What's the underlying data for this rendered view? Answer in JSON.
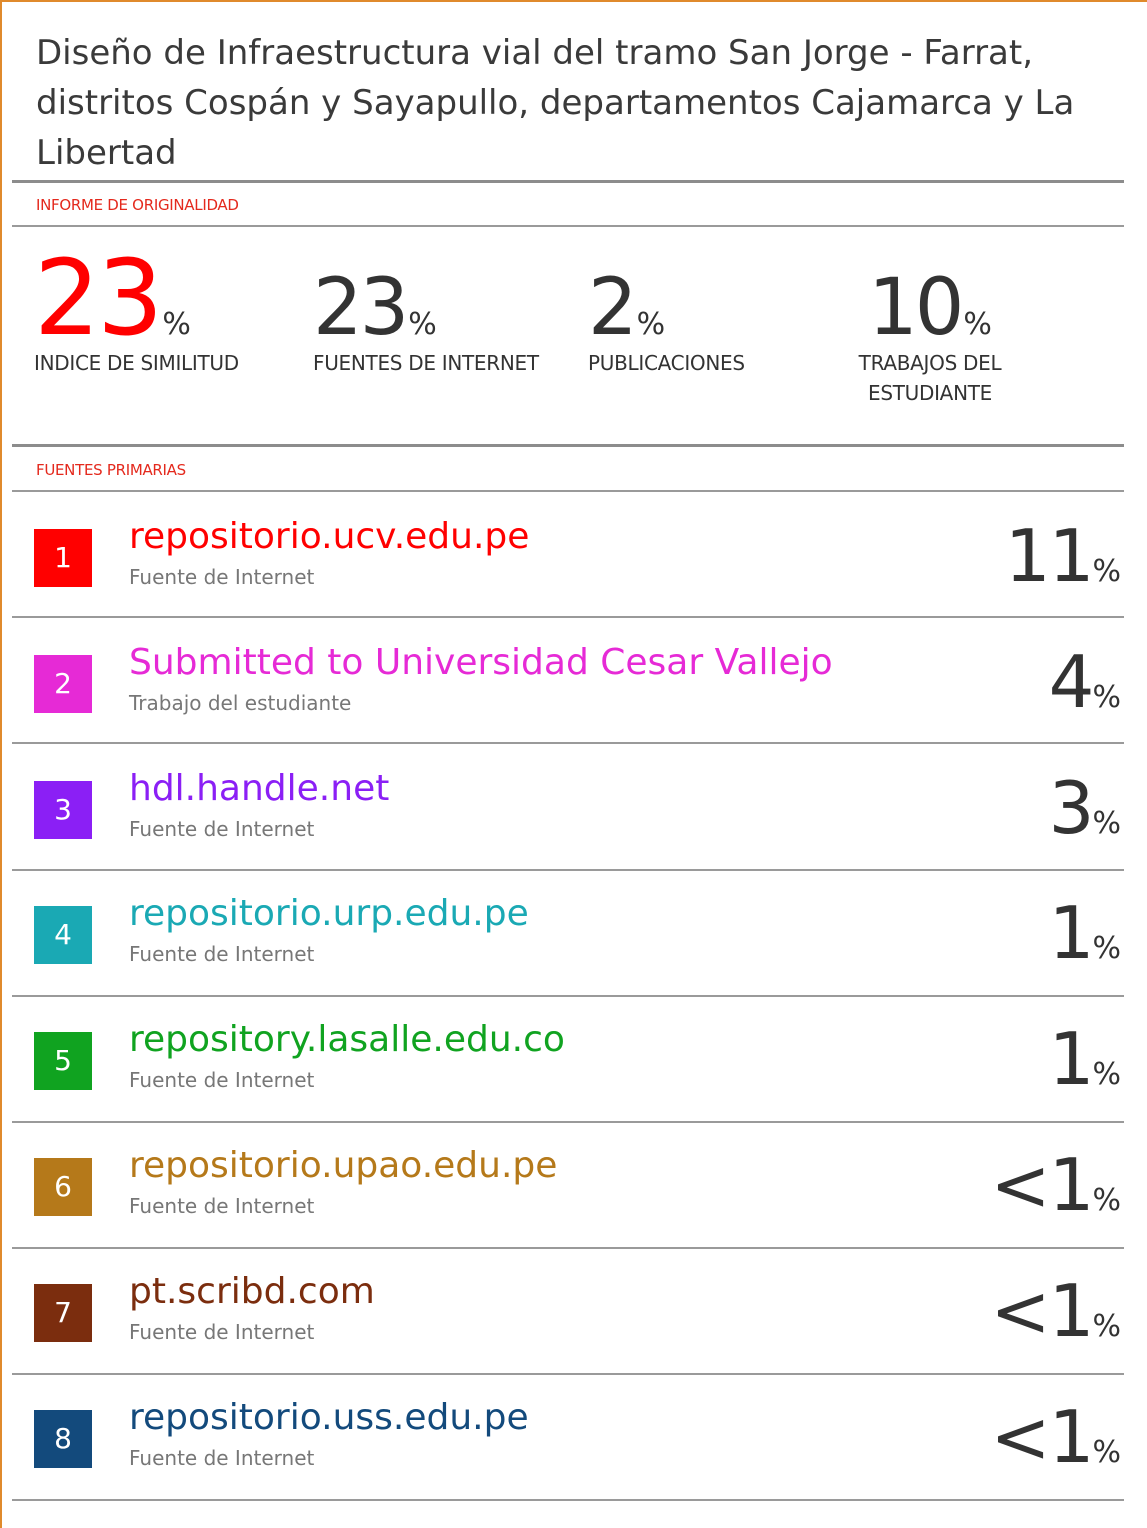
{
  "report": {
    "title": "Diseño de Infraestructura vial del tramo San Jorge - Farrat, distritos Cospán y Sayapullo, departamentos Cajamarca y La Libertad",
    "originality_label": "INFORME DE ORIGINALIDAD",
    "primary_sources_label": "FUENTES PRIMARIAS"
  },
  "stats": [
    {
      "value": "23",
      "unit": "%",
      "label": "INDICE DE SIMILITUD"
    },
    {
      "value": "23",
      "unit": "%",
      "label": "FUENTES DE INTERNET"
    },
    {
      "value": "2",
      "unit": "%",
      "label": "PUBLICACIONES"
    },
    {
      "value": "10",
      "unit": "%",
      "label": "TRABAJOS DEL ESTUDIANTE"
    }
  ],
  "sources": [
    {
      "rank": "1",
      "name": "repositorio.ucv.edu.pe",
      "type": "Fuente de Internet",
      "percent": "11",
      "unit": "%",
      "color": "#ff0000"
    },
    {
      "rank": "2",
      "name": "Submitted to Universidad Cesar Vallejo",
      "type": "Trabajo del estudiante",
      "percent": "4",
      "unit": "%",
      "color": "#e62ad6"
    },
    {
      "rank": "3",
      "name": "hdl.handle.net",
      "type": "Fuente de Internet",
      "percent": "3",
      "unit": "%",
      "color": "#8b1ff5"
    },
    {
      "rank": "4",
      "name": "repositorio.urp.edu.pe",
      "type": "Fuente de Internet",
      "percent": "1",
      "unit": "%",
      "color": "#1aa9b4"
    },
    {
      "rank": "5",
      "name": "repository.lasalle.edu.co",
      "type": "Fuente de Internet",
      "percent": "1",
      "unit": "%",
      "color": "#10a320"
    },
    {
      "rank": "6",
      "name": "repositorio.upao.edu.pe",
      "type": "Fuente de Internet",
      "percent": "<1",
      "unit": "%",
      "color": "#b5791a"
    },
    {
      "rank": "7",
      "name": "pt.scribd.com",
      "type": "Fuente de Internet",
      "percent": "<1",
      "unit": "%",
      "color": "#7b2d0e"
    },
    {
      "rank": "8",
      "name": "repositorio.uss.edu.pe",
      "type": "Fuente de Internet",
      "percent": "<1",
      "unit": "%",
      "color": "#134a7c"
    }
  ]
}
